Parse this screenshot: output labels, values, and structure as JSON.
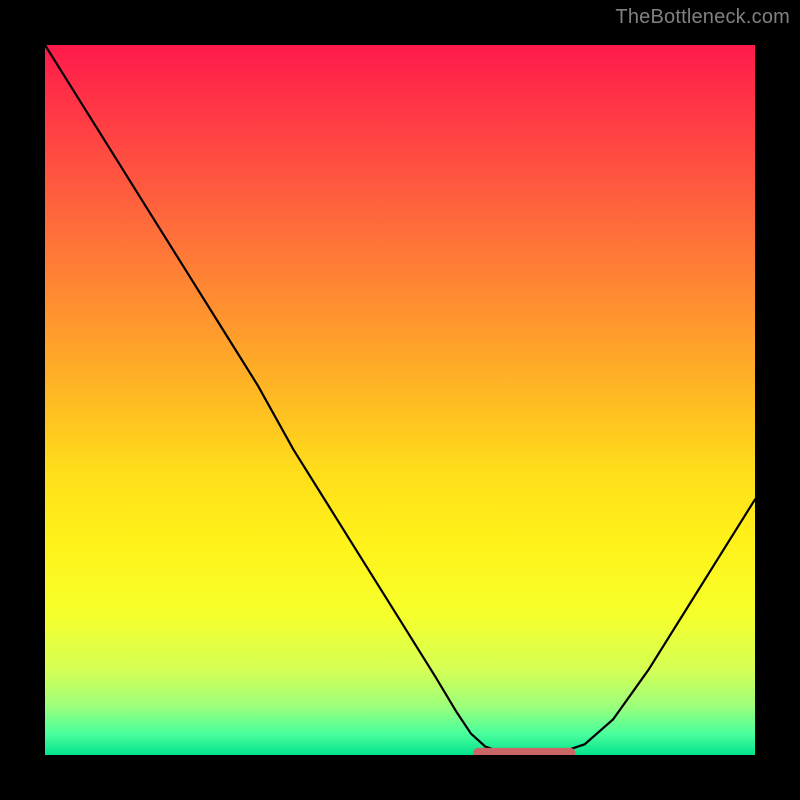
{
  "attribution": "TheBottleneck.com",
  "colors": {
    "page_bg": "#000000",
    "attribution_text": "#808080",
    "curve_stroke": "#000000",
    "marker_stroke": "#cc6666",
    "gradient_top": "#ff1a4b",
    "gradient_bottom": "#04e38b"
  },
  "chart_data": {
    "type": "line",
    "title": "",
    "xlabel": "",
    "ylabel": "",
    "xlim": [
      0,
      100
    ],
    "ylim": [
      0,
      100
    ],
    "grid": false,
    "legend": false,
    "x": [
      0,
      5,
      10,
      15,
      20,
      25,
      30,
      35,
      40,
      45,
      50,
      55,
      58,
      60,
      62,
      64,
      67,
      70,
      73,
      76,
      80,
      85,
      90,
      95,
      100
    ],
    "values": [
      100,
      92,
      84,
      76,
      68,
      60,
      52,
      43,
      35,
      27,
      19,
      11,
      6,
      3,
      1.2,
      0.5,
      0.2,
      0.2,
      0.5,
      1.5,
      5,
      12,
      20,
      28,
      36
    ],
    "annotations": [
      {
        "type": "highlight",
        "x_start": 61,
        "x_end": 74,
        "y": 0.3
      }
    ]
  }
}
